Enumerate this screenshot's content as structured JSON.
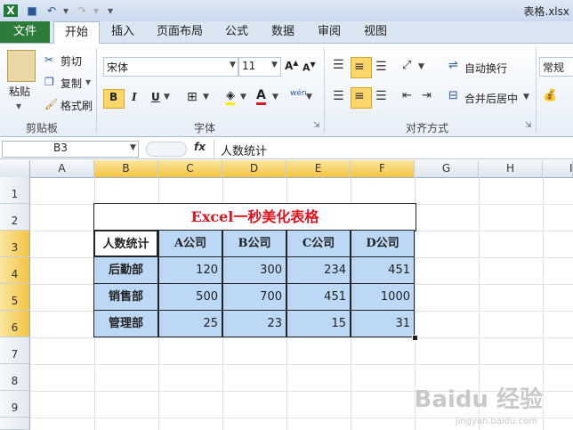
{
  "window": {
    "title": "表格.xlsx"
  },
  "tabs": {
    "file": "文件",
    "home": "开始",
    "insert": "插入",
    "layout": "页面布局",
    "formulas": "公式",
    "data": "数据",
    "review": "审阅",
    "view": "视图"
  },
  "clipboard": {
    "paste": "粘贴",
    "cut": "剪切",
    "copy": "复制",
    "format_painter": "格式刷",
    "label": "剪贴板"
  },
  "font": {
    "name": "宋体",
    "size": "11",
    "bold": "B",
    "italic": "I",
    "underline": "U",
    "label": "字体",
    "phonetic": "wén"
  },
  "alignment": {
    "wrap": "自动换行",
    "merge": "合并后居中",
    "label": "对齐方式"
  },
  "number": {
    "format": "常规"
  },
  "formula_bar": {
    "name_box": "B3",
    "fx": "fx",
    "value": "人数统计"
  },
  "columns": [
    "A",
    "B",
    "C",
    "D",
    "E",
    "F",
    "G",
    "H",
    "I"
  ],
  "rows": [
    "1",
    "2",
    "3",
    "4",
    "5",
    "6",
    "7",
    "8",
    "9"
  ],
  "table": {
    "title": "Excel一秒美化表格",
    "headers": [
      "人数统计",
      "A公司",
      "B公司",
      "C公司",
      "D公司"
    ],
    "rows": [
      {
        "label": "后勤部",
        "values": [
          "120",
          "300",
          "234",
          "451"
        ]
      },
      {
        "label": "销售部",
        "values": [
          "500",
          "700",
          "451",
          "1000"
        ]
      },
      {
        "label": "管理部",
        "values": [
          "25",
          "23",
          "15",
          "31"
        ]
      }
    ]
  },
  "watermark": {
    "main": "Baidu 经验",
    "sub": "jingyan.baidu.com"
  }
}
